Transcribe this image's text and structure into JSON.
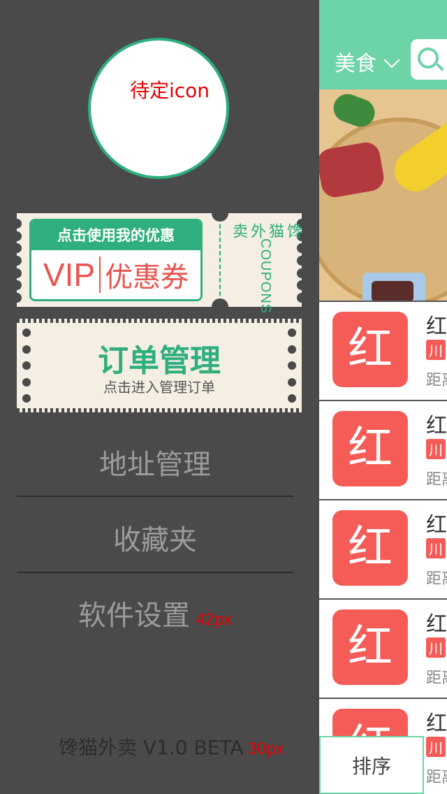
{
  "drawer": {
    "avatar_placeholder": "待定icon",
    "coupon": {
      "headline": "点击使用我的优惠",
      "vip": "VIP",
      "title": "优惠券",
      "brand_cn": "馋猫外卖",
      "brand_en": "COUPONS"
    },
    "orders": {
      "title": "订单管理",
      "subtitle": "点击进入管理订单"
    },
    "menu": [
      {
        "label": "地址管理",
        "note": ""
      },
      {
        "label": "收藏夹",
        "note": ""
      },
      {
        "label": "软件设置",
        "note": "42px"
      }
    ],
    "footer": {
      "text": "馋猫外卖 V1.0 BETA",
      "note": "30px"
    }
  },
  "main": {
    "category": "美食",
    "list": [
      {
        "logo": "红",
        "name": "红",
        "tag": "川",
        "distance": "距离"
      },
      {
        "logo": "红",
        "name": "红",
        "tag": "川",
        "distance": "距离"
      },
      {
        "logo": "红",
        "name": "红",
        "tag": "川",
        "distance": "距离"
      },
      {
        "logo": "红",
        "name": "红",
        "tag": "川",
        "distance": "距离"
      },
      {
        "logo": "红",
        "name": "红",
        "tag": "川",
        "distance": "距离"
      }
    ],
    "sort_label": "排序"
  },
  "colors": {
    "accent_green": "#2eaf7d",
    "topbar_green": "#6dd4a8",
    "red": "#f55b57",
    "drawer_bg": "#4a4a4a"
  }
}
